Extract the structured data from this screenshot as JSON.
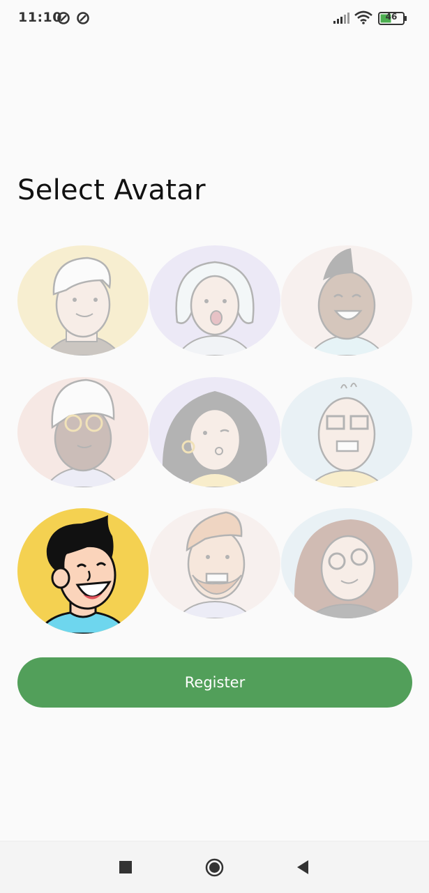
{
  "status_bar": {
    "time": "11:10",
    "battery_level": "46",
    "icons": [
      "data-saver-icon",
      "data-saver-icon",
      "signal-icon",
      "wifi-icon",
      "battery-icon"
    ]
  },
  "page": {
    "title": "Select Avatar"
  },
  "avatars": [
    {
      "name": "avatar-1",
      "selected": false,
      "bg": "#f6e6b4"
    },
    {
      "name": "avatar-2",
      "selected": false,
      "bg": "#e8e4f6"
    },
    {
      "name": "avatar-3",
      "selected": false,
      "bg": "#f7ecea"
    },
    {
      "name": "avatar-4",
      "selected": false,
      "bg": "#f5ddd8"
    },
    {
      "name": "avatar-5",
      "selected": false,
      "bg": "#e8e4f6"
    },
    {
      "name": "avatar-6",
      "selected": false,
      "bg": "#e3eef3"
    },
    {
      "name": "avatar-7",
      "selected": true,
      "bg": "#f4d151"
    },
    {
      "name": "avatar-8",
      "selected": false,
      "bg": "#f7ecea"
    },
    {
      "name": "avatar-9",
      "selected": false,
      "bg": "#e3eef3"
    }
  ],
  "actions": {
    "register_label": "Register",
    "register_color": "#529f5a"
  },
  "nav_bar": {
    "buttons": [
      "recents-square-icon",
      "home-circle-icon",
      "back-triangle-icon"
    ]
  }
}
